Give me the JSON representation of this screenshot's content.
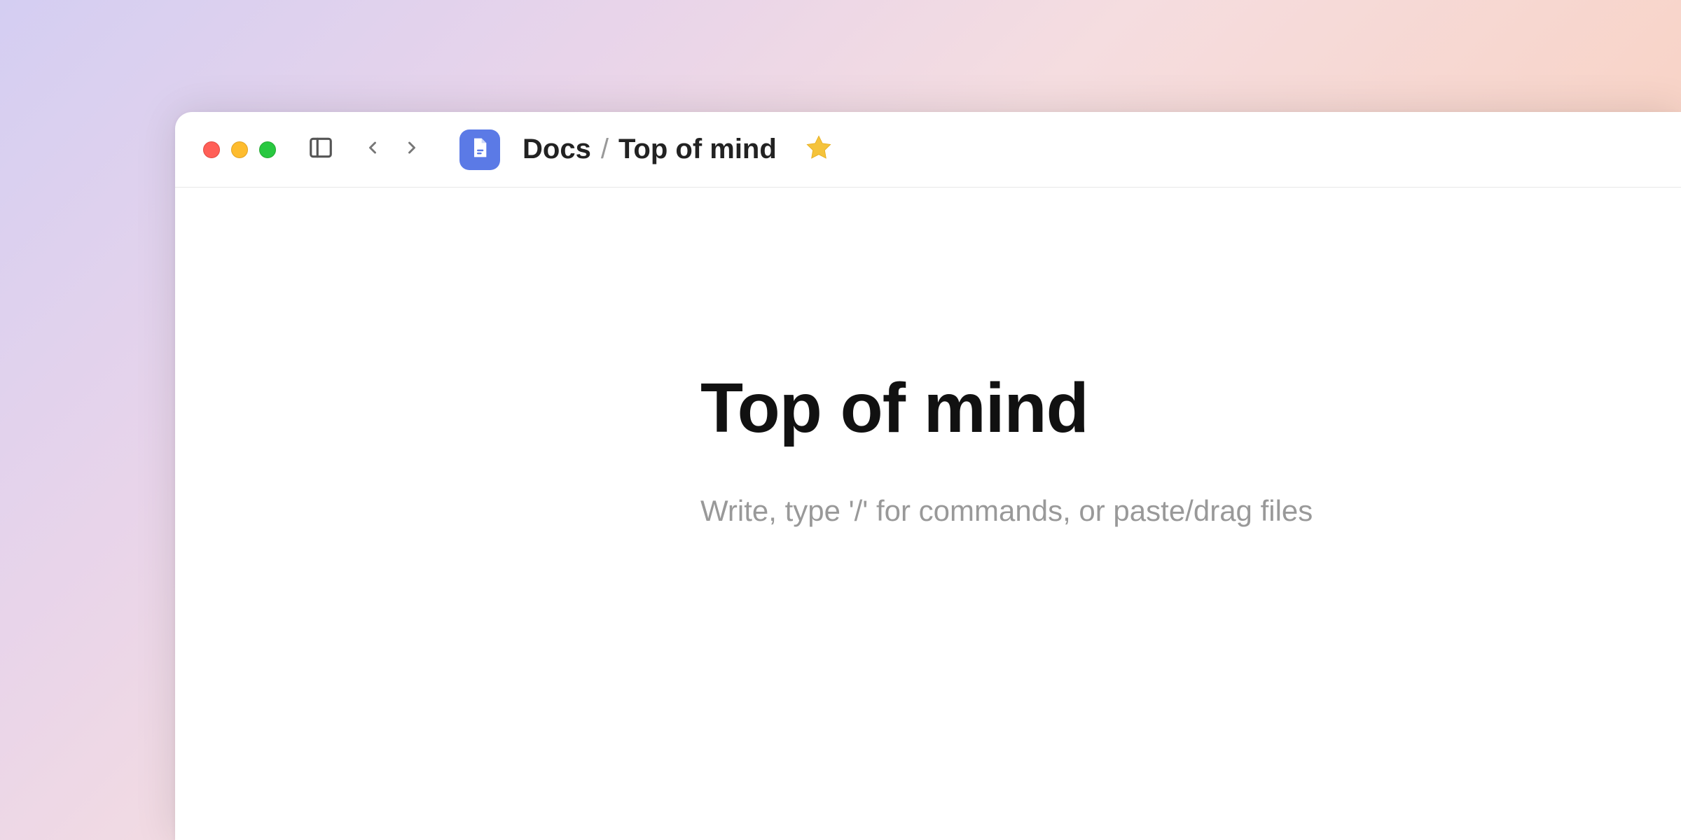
{
  "breadcrumb": {
    "parent": "Docs",
    "separator": "/",
    "current": "Top of mind"
  },
  "document": {
    "title": "Top of mind",
    "body_placeholder": "Write, type '/' for commands, or paste/drag files"
  },
  "icons": {
    "app": "document-icon",
    "favorite": "star-icon"
  },
  "colors": {
    "app_icon_bg": "#5b7ae6",
    "star_fill": "#f5c33b"
  }
}
